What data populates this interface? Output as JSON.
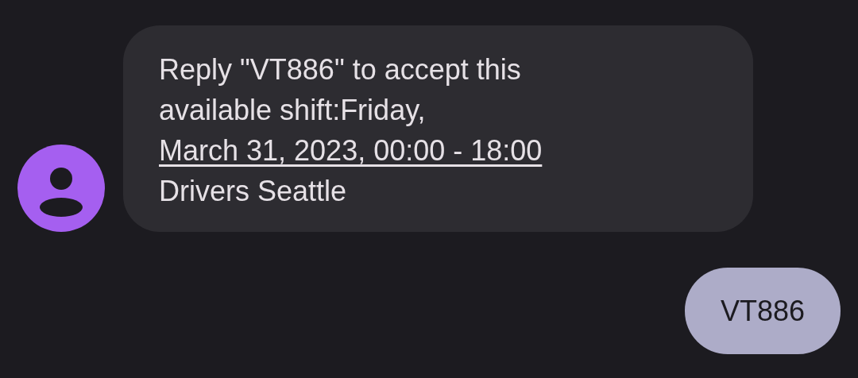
{
  "messages": [
    {
      "kind": "incoming",
      "text_before": "Reply \"VT886\" to accept this available shift:Friday, ",
      "link": "March 31, 2023, 00:00 - 18:00",
      "text_after": "\nDrivers Seattle"
    },
    {
      "kind": "outgoing",
      "text_before": "VT886"
    }
  ]
}
